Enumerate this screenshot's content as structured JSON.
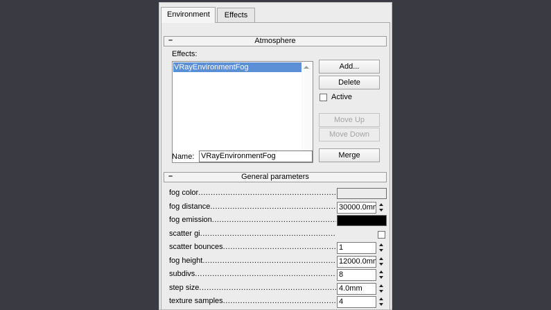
{
  "tabs": [
    {
      "label": "Environment",
      "active": true
    },
    {
      "label": "Effects",
      "active": false
    }
  ],
  "atmosphere": {
    "title": "Atmosphere",
    "collapse_symbol": "–",
    "effects_label": "Effects:",
    "effects": [
      "VRayEnvironmentFog"
    ],
    "add_label": "Add...",
    "delete_label": "Delete",
    "active_label": "Active",
    "active_checked": false,
    "move_up_label": "Move Up",
    "move_down_label": "Move Down",
    "name_label": "Name:",
    "name_value": "VRayEnvironmentFog",
    "merge_label": "Merge"
  },
  "general": {
    "title": "General parameters",
    "collapse_symbol": "–",
    "params": [
      {
        "label": "fog color",
        "type": "color",
        "color": "#ececec"
      },
      {
        "label": "fog distance",
        "type": "spinner",
        "value": "30000.0mm"
      },
      {
        "label": "fog emission",
        "type": "color",
        "color": "#000000"
      },
      {
        "label": "scatter gi",
        "type": "checkbox",
        "checked": false
      },
      {
        "label": "scatter bounces",
        "type": "spinner",
        "value": "1"
      },
      {
        "label": "fog height",
        "type": "spinner",
        "value": "12000.0mm"
      },
      {
        "label": "subdivs",
        "type": "spinner",
        "value": "8"
      },
      {
        "label": "step size",
        "type": "spinner",
        "value": "4.0mm"
      },
      {
        "label": "texture samples",
        "type": "spinner",
        "value": "4"
      }
    ]
  },
  "colors": {
    "background": "#3a3a42",
    "panel": "#ececec",
    "selection": "#5b8fd6"
  }
}
